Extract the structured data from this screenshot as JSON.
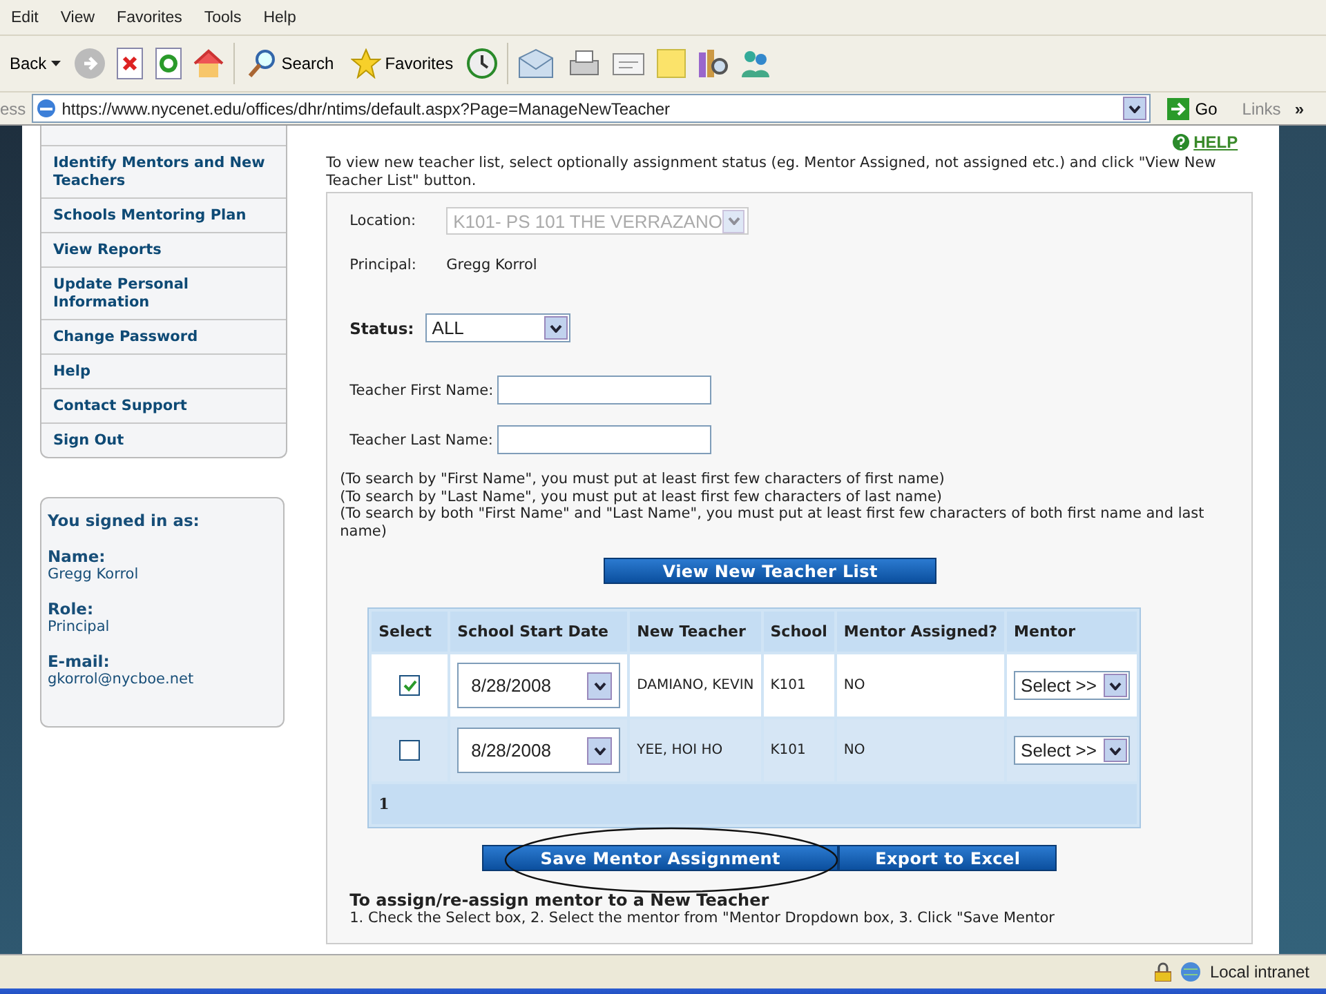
{
  "menu_bar": [
    "Edit",
    "View",
    "Favorites",
    "Tools",
    "Help"
  ],
  "toolbar": {
    "back": "Back",
    "search": "Search",
    "favorites": "Favorites"
  },
  "address_bar": {
    "label": "ess",
    "url": "https://www.nycenet.edu/offices/dhr/ntims/default.aspx?Page=ManageNewTeacher",
    "go": "Go",
    "links": "Links",
    "more": "»"
  },
  "sidebar": {
    "items": [
      "Identify Mentors and New Teachers",
      "Schools Mentoring Plan",
      "View Reports",
      "Update Personal Information",
      "Change Password",
      "Help",
      "Contact Support",
      "Sign Out"
    ],
    "signed_in": {
      "title": "You signed in as:",
      "fields": [
        {
          "label": "Name:",
          "value": "Gregg Korrol"
        },
        {
          "label": "Role:",
          "value": "Principal"
        },
        {
          "label": "E-mail:",
          "value": "gkorrol@nycboe.net"
        }
      ]
    }
  },
  "main": {
    "help": "HELP",
    "intro": "To view new teacher list, select optionally assignment status (eg. Mentor Assigned, not assigned etc.) and click \"View New Teacher List\" button.",
    "location": {
      "label": "Location:",
      "value": "K101- PS 101 THE VERRAZANO",
      "disabled": true
    },
    "principal": {
      "label": "Principal:",
      "value": "Gregg Korrol"
    },
    "status": {
      "label": "Status:",
      "value": "ALL"
    },
    "first_name": {
      "label": "Teacher First Name:"
    },
    "last_name": {
      "label": "Teacher Last Name:"
    },
    "notes": [
      "(To search by \"First Name\", you must put at least first few characters of first name)",
      "(To search by \"Last Name\", you must put at least first few characters of last name)",
      "(To search by both \"First Name\" and \"Last Name\", you must put at least first few characters of both first name and last name)"
    ],
    "view_button": "View New Teacher List",
    "table": {
      "columns": [
        "Select",
        "School Start Date",
        "New Teacher",
        "School",
        "Mentor Assigned?",
        "Mentor"
      ],
      "rows": [
        {
          "selected": true,
          "start_date": "8/28/2008",
          "teacher": "DAMIANO, KEVIN",
          "school": "K101",
          "mentor_assigned": "NO",
          "mentor": "Select >>"
        },
        {
          "selected": false,
          "start_date": "8/28/2008",
          "teacher": "YEE, HOI HO",
          "school": "K101",
          "mentor_assigned": "NO",
          "mentor": "Select >>"
        }
      ],
      "pager": "1"
    },
    "buttons": [
      {
        "label": "Save Mentor Assignment",
        "highlighted": true
      },
      {
        "label": "Export to Excel",
        "highlighted": false
      }
    ],
    "instructions": {
      "title": "To assign/re-assign mentor to a New Teacher",
      "text": "1. Check the Select box, 2. Select the mentor from \"Mentor Dropdown box, 3. Click \"Save Mentor"
    }
  },
  "status_bar": {
    "zone": "Local intranet"
  }
}
